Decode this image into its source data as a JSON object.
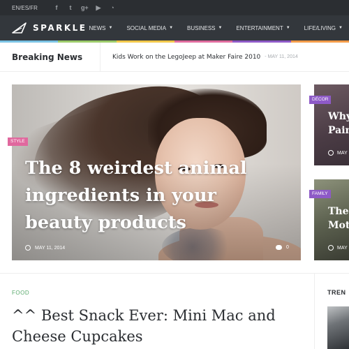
{
  "topbar": {
    "lang_en": "EN",
    "lang_sep1": " / ",
    "lang_es": "ES",
    "lang_sep2": " / ",
    "lang_fr": "FR",
    "social": [
      {
        "icon": "facebook-icon",
        "glyph": "f"
      },
      {
        "icon": "twitter-icon",
        "glyph": "t"
      },
      {
        "icon": "google-plus-icon",
        "glyph": "g+"
      },
      {
        "icon": "youtube-icon",
        "glyph": "▶"
      },
      {
        "icon": "rss-icon",
        "glyph": "◔"
      }
    ]
  },
  "nav": {
    "logo_text": "SPARKLE",
    "items": [
      {
        "label": "NEWS",
        "caret": "▼"
      },
      {
        "label": "SOCIAL MEDIA",
        "caret": "▼"
      },
      {
        "label": "BUSINESS",
        "caret": "▼"
      },
      {
        "label": "ENTERTAINMENT",
        "caret": "▼"
      },
      {
        "label": "LIFE/LIVING",
        "caret": "▼"
      }
    ],
    "rainbow_colors": [
      "#7bc3e4",
      "#9ccb6b",
      "#f2c84b",
      "#e06c9f",
      "#8e5ac7",
      "#f39c4a"
    ]
  },
  "breaking": {
    "label": "Breaking News",
    "headline": "Kids Work on the LegoJeep at Maker Faire 2010",
    "date": "- MAY 11, 2014"
  },
  "hero": {
    "tag": "STYLE",
    "title": "The 8 weirdest animal ingredients in your beauty products",
    "date": "MAY 11, 2014",
    "comments": "0"
  },
  "side_cards": [
    {
      "tag": "DÉCOR",
      "title_line1": "Why",
      "title_line2": "Pain",
      "date": "MAY"
    },
    {
      "tag": "FAMILY",
      "title_line1": "Thes",
      "title_line2": "Moth",
      "date": "MAY"
    }
  ],
  "latest": {
    "category": "FOOD",
    "title": "^^ Best Snack Ever: Mini Mac and Cheese Cupcakes"
  },
  "trending": {
    "label": "TREN"
  },
  "colors": {
    "topbar_bg": "#2b2e32",
    "nav_bg": "#33373c",
    "tag_style": "#e0689e",
    "tag_decor": "#8e5ac7",
    "food_green": "#5aaa6d"
  }
}
